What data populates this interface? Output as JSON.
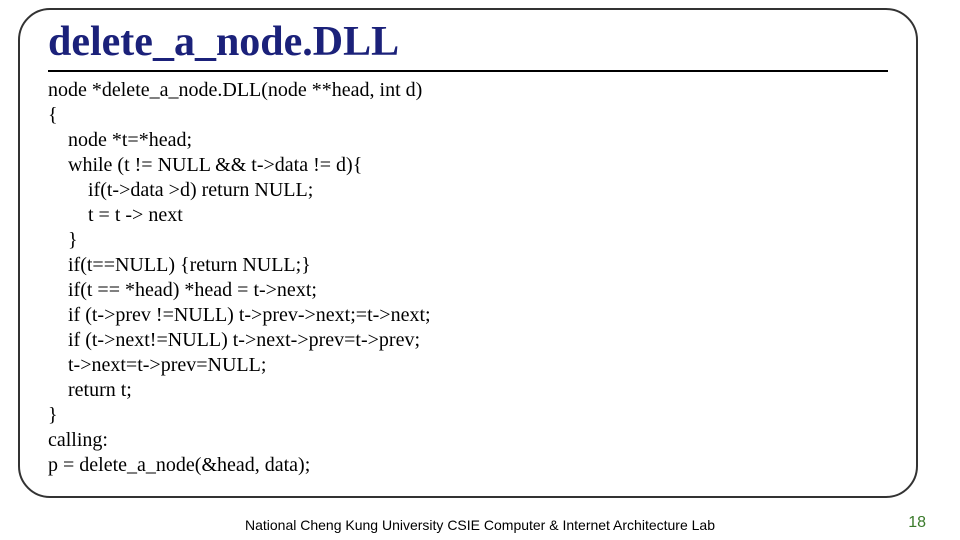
{
  "title": "delete_a_node.DLL",
  "code_lines": [
    "node *delete_a_node.DLL(node **head, int d)",
    "{",
    "    node *t=*head;",
    "    while (t != NULL && t->data != d){",
    "        if(t->data >d) return NULL;",
    "        t = t -> next",
    "    }",
    "    if(t==NULL) {return NULL;}",
    "    if(t == *head) *head = t->next;",
    "    if (t->prev !=NULL) t->prev->next;=t->next;",
    "    if (t->next!=NULL) t->next->prev=t->prev;",
    "    t->next=t->prev=NULL;",
    "    return t;",
    "}",
    "calling:",
    "p = delete_a_node(&head, data);"
  ],
  "footer": "National Cheng Kung University CSIE Computer & Internet Architecture Lab",
  "page_number": "18"
}
